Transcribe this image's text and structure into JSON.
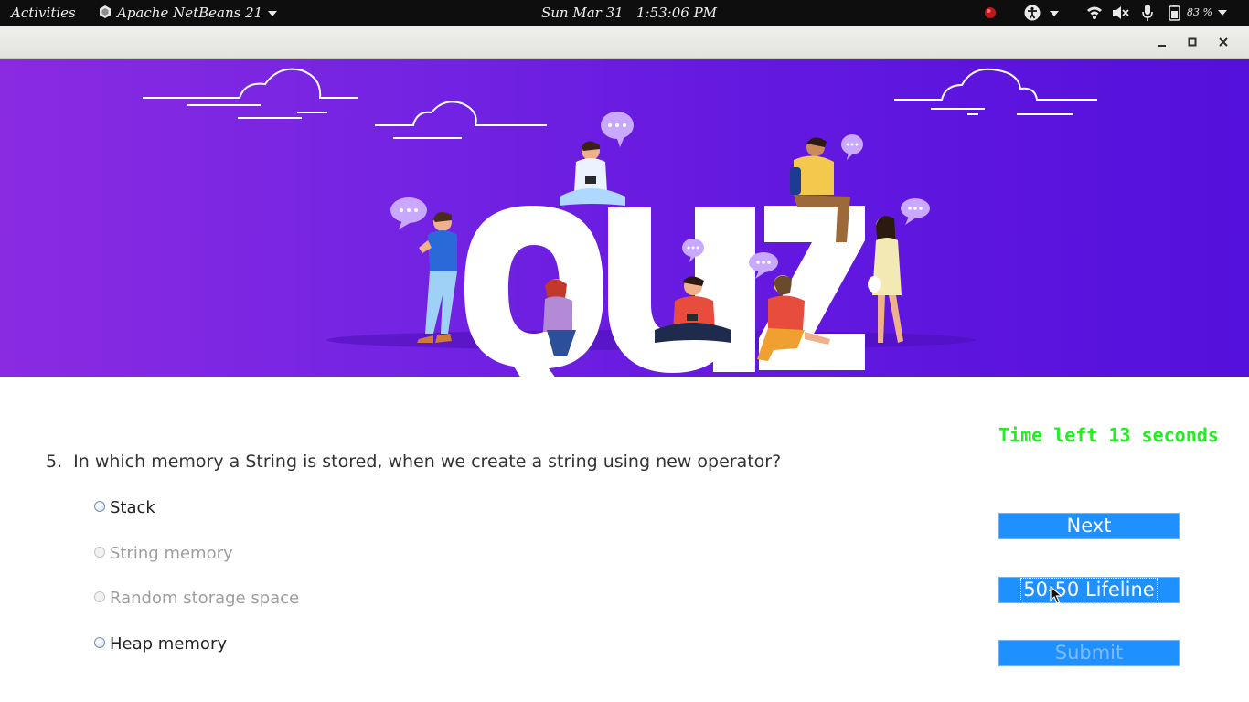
{
  "topbar": {
    "activities": "Activities",
    "app_name": "Apache NetBeans 21",
    "datetime": "Sun Mar 31   1:53:06 PM",
    "battery": "83 %"
  },
  "banner": {
    "word": "QUIZ"
  },
  "quiz": {
    "timer": "Time left 13 seconds",
    "question_number": "5.",
    "question_text": "In which memory a String is stored, when we create a string using new operator?",
    "options": [
      {
        "label": "Stack",
        "enabled": true
      },
      {
        "label": "String memory",
        "enabled": false
      },
      {
        "label": "Random storage space",
        "enabled": false
      },
      {
        "label": "Heap memory",
        "enabled": true
      }
    ],
    "buttons": {
      "next": "Next",
      "lifeline": "50-50 Lifeline",
      "submit": "Submit"
    }
  },
  "colors": {
    "timer": "#22ee22",
    "button": "#1e90ff",
    "banner_left": "#8a2be2",
    "banner_right": "#5410dc"
  }
}
